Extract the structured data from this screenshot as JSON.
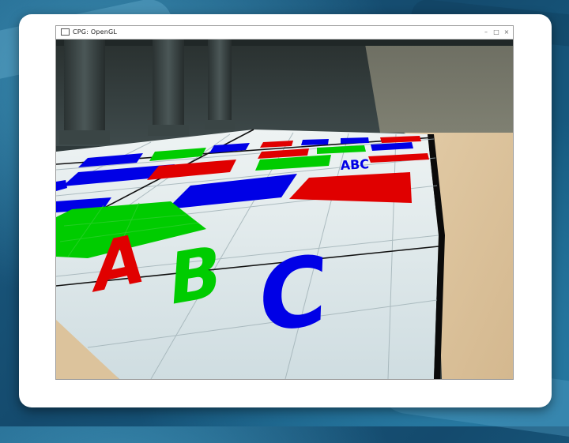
{
  "window": {
    "title": "CPG: OpenGL",
    "app_icon": "window-app-icon",
    "controls": {
      "minimize": "–",
      "maximize": "□",
      "close": "×"
    }
  },
  "scene": {
    "floor_text_far": "ABC",
    "floor_text_near": {
      "a": "A",
      "b": "B",
      "c": "C"
    },
    "colors": {
      "red": "#e00000",
      "green": "#00cc00",
      "blue": "#0000e6",
      "floor": "#d8e3e6",
      "sand": "#dcc29c",
      "wall": "#3c4748"
    }
  }
}
